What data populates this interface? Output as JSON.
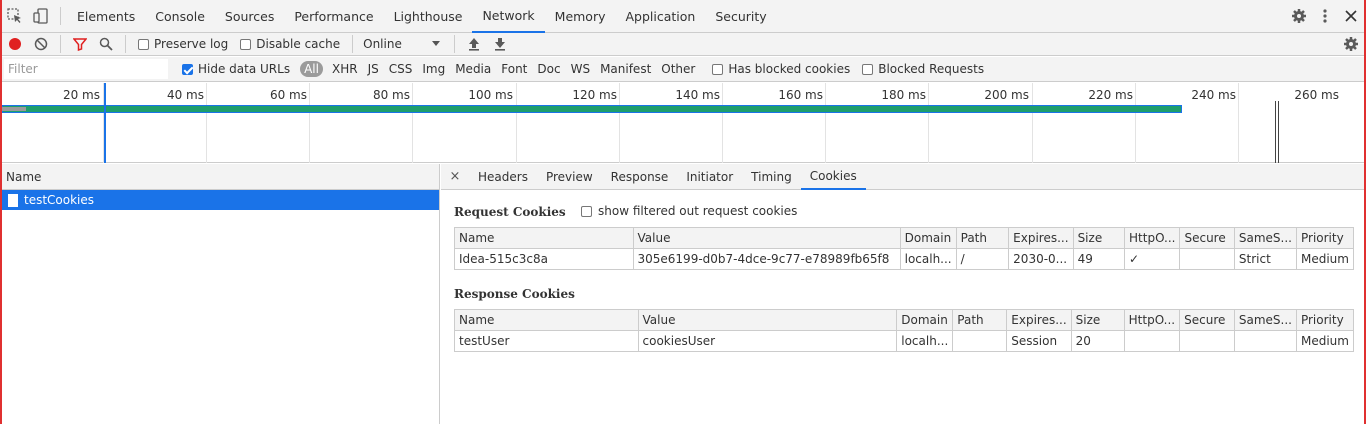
{
  "main_toolbar": {
    "tabs": [
      "Elements",
      "Console",
      "Sources",
      "Performance",
      "Lighthouse",
      "Network",
      "Memory",
      "Application",
      "Security"
    ],
    "active_tab": "Network"
  },
  "network_toolbar": {
    "preserve_log": "Preserve log",
    "disable_cache": "Disable cache",
    "throttle": "Online"
  },
  "filter_bar": {
    "placeholder": "Filter",
    "hide_data_urls": "Hide data URLs",
    "types": [
      "All",
      "XHR",
      "JS",
      "CSS",
      "Img",
      "Media",
      "Font",
      "Doc",
      "WS",
      "Manifest",
      "Other"
    ],
    "has_blocked_cookies": "Has blocked cookies",
    "blocked_requests": "Blocked Requests"
  },
  "overview": {
    "labels": [
      "20 ms",
      "40 ms",
      "60 ms",
      "80 ms",
      "100 ms",
      "120 ms",
      "140 ms",
      "160 ms",
      "180 ms",
      "200 ms",
      "220 ms",
      "240 ms",
      "260 ms"
    ]
  },
  "request_list": {
    "column": "Name",
    "items": [
      "testCookies"
    ]
  },
  "details": {
    "close": "×",
    "tabs": [
      "Headers",
      "Preview",
      "Response",
      "Initiator",
      "Timing",
      "Cookies"
    ],
    "active_tab": "Cookies",
    "request_title": "Request Cookies",
    "show_filtered": "show filtered out request cookies",
    "response_title": "Response Cookies",
    "columns": [
      "Name",
      "Value",
      "Domain",
      "Path",
      "Expires...",
      "Size",
      "HttpO...",
      "Secure",
      "SameS...",
      "Priority"
    ],
    "request_rows": [
      [
        "Idea-515c3c8a",
        "305e6199-d0b7-4dce-9c77-e78989fb65f8",
        "localh...",
        "/",
        "2030-0...",
        "49",
        "✓",
        "",
        "Strict",
        "Medium"
      ]
    ],
    "response_rows": [
      [
        "testUser",
        "cookiesUser",
        "localh...",
        "",
        "Session",
        "20",
        "",
        "",
        "",
        "Medium"
      ]
    ]
  },
  "colors": {
    "accent": "#1a73e8",
    "record": "#e02020",
    "frame": "#e03030"
  }
}
